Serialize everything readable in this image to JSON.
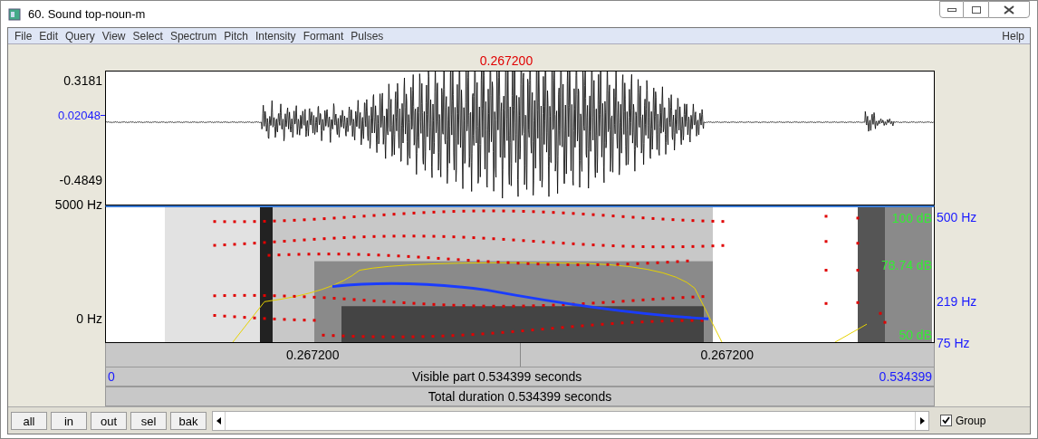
{
  "window": {
    "title": "60. Sound top-noun-m"
  },
  "menu": [
    {
      "label": "File"
    },
    {
      "label": "Edit"
    },
    {
      "label": "Query"
    },
    {
      "label": "View"
    },
    {
      "label": "Select"
    },
    {
      "label": "Spectrum"
    },
    {
      "label": "Pitch"
    },
    {
      "label": "Intensity"
    },
    {
      "label": "Formant"
    },
    {
      "label": "Pulses"
    }
  ],
  "help": "Help",
  "cursor_time": "0.267200",
  "waveform": {
    "y_max": "0.3181",
    "y_cursor": "0.02048",
    "y_min": "-0.4849"
  },
  "spectrogram": {
    "freq_max": "5000 Hz",
    "freq_min": "0 Hz",
    "intensity_max": "100 dB",
    "intensity_value": "78.74 dB",
    "intensity_min": "50 dB",
    "pitch_max": "500 Hz",
    "pitch_value": "219 Hz",
    "pitch_min": "75 Hz"
  },
  "time_bar": {
    "left_segment": "0.267200",
    "right_segment": "0.267200",
    "visible_start": "0",
    "visible_label": "Visible part 0.534399 seconds",
    "visible_end": "0.534399",
    "total": "Total duration 0.534399 seconds"
  },
  "buttons": [
    "all",
    "in",
    "out",
    "sel",
    "bak"
  ],
  "group": {
    "label": "Group",
    "checked": true
  }
}
